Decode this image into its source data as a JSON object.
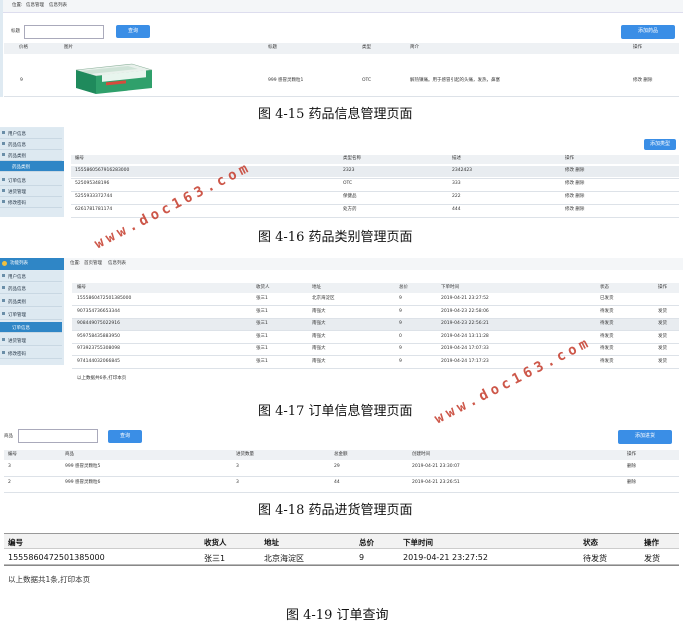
{
  "s1": {
    "breadcrumb": [
      "位置:",
      "信息管理",
      "信息列表"
    ],
    "search_label": "标题",
    "search_button": "查询",
    "add_button": "添加药品",
    "headers": [
      "价格",
      "图片",
      "标题",
      "类型",
      "简介",
      "操作"
    ],
    "row": {
      "price": "9",
      "title": "999 感冒灵颗粒1",
      "type": "OTC",
      "intro": "解热镇痛。用于感冒引起的头痛，发热，鼻塞",
      "ops": "修改 删除"
    },
    "caption": "图 4-15 药品信息管理页面"
  },
  "s2": {
    "sidebar": [
      "用户信息",
      "药品信息",
      "药品类别",
      "药品类别",
      "订单信息",
      "进货管理",
      "修改密码"
    ],
    "add_button": "添加类型",
    "headers": [
      "编号",
      "类型名称",
      "描述",
      "操作"
    ],
    "rows": [
      [
        "1555860567916283000",
        "2323",
        "2342423",
        "修改 删除"
      ],
      [
        "525095348196",
        "OTC",
        "333",
        "修改 删除"
      ],
      [
        "5255933372744",
        "保健品",
        "222",
        "修改 删除"
      ],
      [
        "6261781781174",
        "处方药",
        "444",
        "修改 删除"
      ]
    ],
    "caption": "图 4-16 药品类别管理页面"
  },
  "s3": {
    "title": "功能列表",
    "breadcrumb": [
      "位置:",
      "首页管理",
      "信息列表"
    ],
    "sidebar": [
      "用户信息",
      "药品信息",
      "药品类别",
      "订单管理",
      "订单信息",
      "进货管理",
      "修改密码"
    ],
    "headers": [
      "编号",
      "收货人",
      "地址",
      "总价",
      "下单时间",
      "状态",
      "操作"
    ],
    "rows": [
      [
        "1555860472501385000",
        "张三1",
        "北京海淀区",
        "9",
        "2019-04-21 23:27:52",
        "已发货",
        ""
      ],
      [
        "907354736653344",
        "张三1",
        "南强大",
        "9",
        "2019-04-23 22:58:06",
        "待发货",
        "发货"
      ],
      [
        "908449075022916",
        "张三1",
        "南强大",
        "9",
        "2019-04-23 22:56:21",
        "待发货",
        "发货"
      ],
      [
        "959758435883950",
        "张三1",
        "南强大",
        "0",
        "2019-04-24 13:11:28",
        "待发货",
        "发货"
      ],
      [
        "973923755308098",
        "张三1",
        "南强大",
        "9",
        "2019-04-24 17:07:33",
        "待发货",
        "发货"
      ],
      [
        "974144032066845",
        "张三1",
        "南强大",
        "9",
        "2019-04-24 17:17:23",
        "待发货",
        "发货"
      ]
    ],
    "footer": "以上数据共6条,打印本页",
    "caption": "图 4-17 订单信息管理页面"
  },
  "s4": {
    "search_label": "商品",
    "search_button": "查询",
    "add_button": "添加进货",
    "headers": [
      "编号",
      "商品",
      "进货数量",
      "总金额",
      "创建时间",
      "操作"
    ],
    "rows": [
      [
        "3",
        "999 感冒灵颗粒5",
        "3",
        "29",
        "2019-04-21 23:30:07",
        "删除"
      ],
      [
        "2",
        "999 感冒灵颗粒6",
        "3",
        "44",
        "2019-04-21 23:26:51",
        "删除"
      ]
    ],
    "caption": "图 4-18 药品进货管理页面"
  },
  "s5": {
    "headers": [
      "编号",
      "收货人",
      "地址",
      "总价",
      "下单时间",
      "状态",
      "操作"
    ],
    "row": [
      "1555860472501385000",
      "张三1",
      "北京海淀区",
      "9",
      "2019-04-21 23:27:52",
      "待发货",
      "发货"
    ],
    "footer": "以上数据共1条,打印本页",
    "caption": "图 4-19 订单查询"
  },
  "watermark": "www.doc163.com",
  "colors": {
    "accent": "#3a8ee6",
    "active": "#2f86c6",
    "watermark": "#c53a2a"
  }
}
